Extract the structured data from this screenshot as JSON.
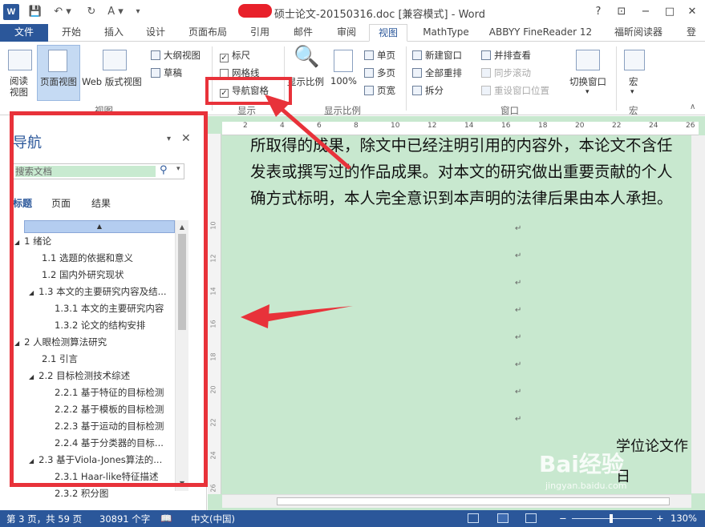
{
  "titlebar": {
    "app_icon": "W",
    "doc_title": "硕士论文-20150316.doc [兼容模式] - Word",
    "help": "?",
    "controls": [
      "−",
      "□",
      "✕"
    ]
  },
  "tabs": [
    {
      "label": "文件"
    },
    {
      "label": "开始"
    },
    {
      "label": "插入"
    },
    {
      "label": "设计"
    },
    {
      "label": "页面布局"
    },
    {
      "label": "引用"
    },
    {
      "label": "邮件"
    },
    {
      "label": "审阅"
    },
    {
      "label": "视图"
    },
    {
      "label": "MathType"
    },
    {
      "label": "ABBYY FineReader 12"
    },
    {
      "label": "福昕阅读器"
    },
    {
      "label": "登"
    }
  ],
  "ribbon": {
    "views": {
      "read": "阅读\n视图",
      "read_l1": "阅读",
      "read_l2": "视图",
      "print": "页面视图",
      "web": "Web 版式视图",
      "outline": "大纲视图",
      "draft": "草稿",
      "group": "视图"
    },
    "show": {
      "ruler": "标尺",
      "gridlines": "网格线",
      "nav_pane": "导航窗格",
      "group": "显示"
    },
    "zoom": {
      "zoom": "显示比例",
      "pct": "100%",
      "one_page": "单页",
      "multi_page": "多页",
      "page_width": "页宽",
      "group": "显示比例"
    },
    "window": {
      "new_window": "新建窗口",
      "arrange_all": "全部重排",
      "split": "拆分",
      "side_by_side": "并排查看",
      "sync_scroll": "同步滚动",
      "reset_pos": "重设窗口位置",
      "switch": "切换窗口",
      "group": "窗口"
    },
    "macros": {
      "macro": "宏",
      "group": "宏"
    }
  },
  "nav": {
    "title": "导航",
    "search_placeholder": "搜索文档",
    "tabs": [
      "标题",
      "页面",
      "结果"
    ],
    "tree": [
      {
        "text": "1 绪论",
        "level": 0,
        "expanded": true
      },
      {
        "text": "1.1 选题的依据和意义",
        "level": 1,
        "expanded": false
      },
      {
        "text": "1.2 国内外研究现状",
        "level": 1,
        "expanded": false
      },
      {
        "text": "1.3 本文的主要研究内容及结...",
        "level": 1,
        "expanded": true
      },
      {
        "text": "1.3.1  本文的主要研究内容",
        "level": 2,
        "expanded": false
      },
      {
        "text": "1.3.2  论文的结构安排",
        "level": 2,
        "expanded": false
      },
      {
        "text": "2 人眼检测算法研究",
        "level": 0,
        "expanded": true
      },
      {
        "text": "2.1 引言",
        "level": 1,
        "expanded": false
      },
      {
        "text": "2.2 目标检测技术综述",
        "level": 1,
        "expanded": true
      },
      {
        "text": "2.2.1  基于特征的目标检测",
        "level": 2,
        "expanded": false
      },
      {
        "text": "2.2.2  基于模板的目标检测",
        "level": 2,
        "expanded": false
      },
      {
        "text": "2.2.3  基于运动的目标检测",
        "level": 2,
        "expanded": false
      },
      {
        "text": "2.2.4  基于分类器的目标...",
        "level": 2,
        "expanded": false
      },
      {
        "text": "2.3 基于Viola-Jones算法的...",
        "level": 1,
        "expanded": true
      },
      {
        "text": "2.3.1  Haar-like特征描述",
        "level": 2,
        "expanded": false
      },
      {
        "text": "2.3.2  积分图",
        "level": 2,
        "expanded": false
      }
    ]
  },
  "ruler": {
    "ticks": [
      "2",
      "4",
      "6",
      "8",
      "10",
      "12",
      "14",
      "16",
      "18",
      "20",
      "22",
      "24",
      "26"
    ],
    "vticks": [
      "10",
      "12",
      "14",
      "16",
      "18",
      "20",
      "22",
      "24",
      "26",
      "28"
    ]
  },
  "document": {
    "lines": [
      "所取得的成果，除文中已经注明引用的内容外，本论文不含任",
      "发表或撰写过的作品成果。对本文的研究做出重要贡献的个人",
      "确方式标明，本人完全意识到本声明的法律后果由本人承担。"
    ],
    "para_mark": "↵",
    "right_text": "学位论文作",
    "right_text2": "日"
  },
  "statusbar": {
    "page": "第 3 页，共 59 页",
    "words": "30891 个字",
    "lang": "中文(中国)",
    "zoom": "130%",
    "minus": "−",
    "plus": "+"
  },
  "watermark": {
    "brand": "Bai经验",
    "url": "jingyan.baidu.com"
  },
  "colors": {
    "accent": "#2b579a",
    "doc_bg": "#c8e8cf",
    "annotation_red": "#e8323a"
  }
}
